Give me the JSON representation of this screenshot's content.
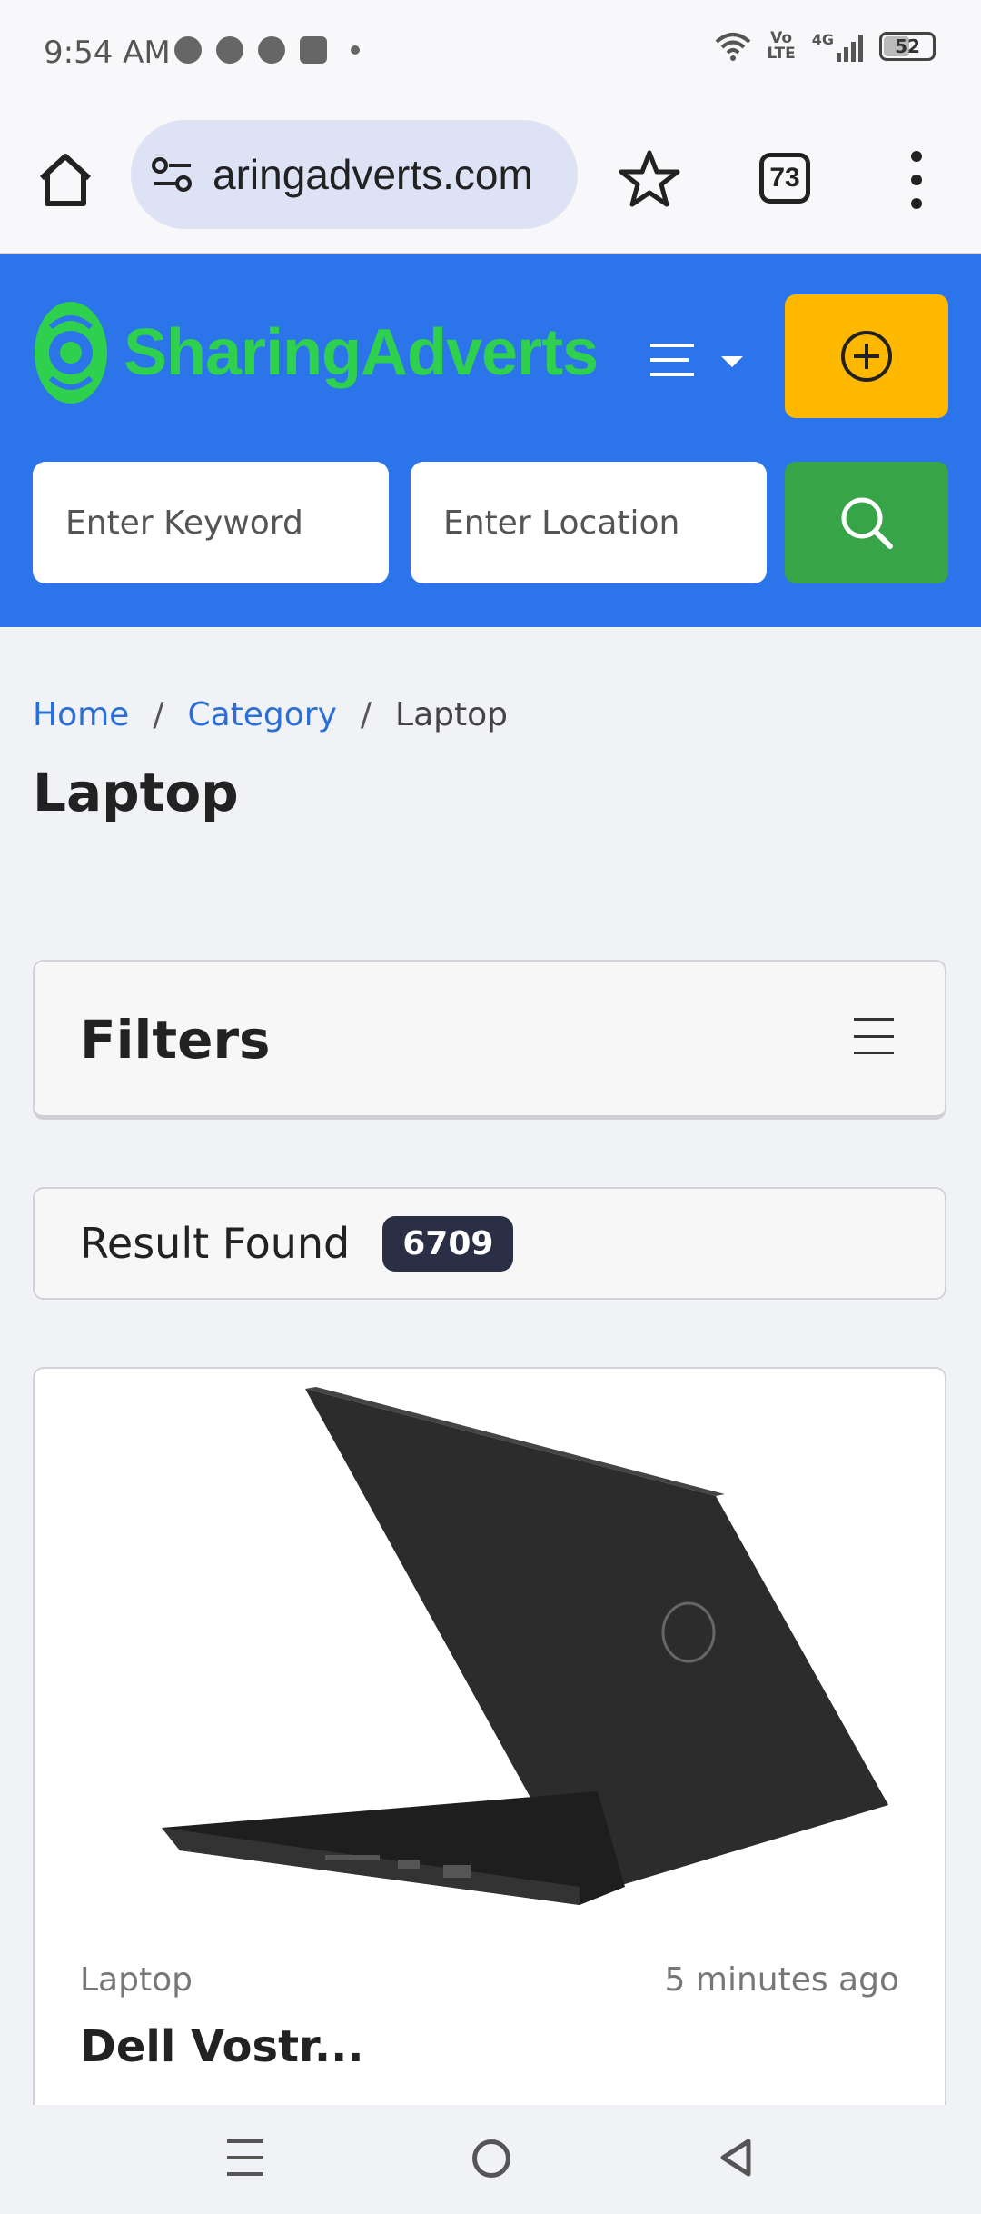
{
  "status_bar": {
    "time": "9:54 AM",
    "volte_label": "Vo\nLTE",
    "network": "4G",
    "battery": "52"
  },
  "browser": {
    "url": "aringadverts.com",
    "tab_count": "73",
    "icons": [
      "home-icon",
      "site-settings-icon",
      "star-icon",
      "tabs-icon",
      "more-vert-icon"
    ]
  },
  "header": {
    "logo_text": "SharingAdverts",
    "keyword_placeholder": "Enter Keyword",
    "location_placeholder": "Enter Location",
    "colors": {
      "header_bg": "#2b74ea",
      "logo": "#2ed04e",
      "add": "#ffb800",
      "search": "#36a447"
    }
  },
  "breadcrumb": {
    "home": "Home",
    "category": "Category",
    "current": "Laptop"
  },
  "page": {
    "title": "Laptop"
  },
  "filters": {
    "title": "Filters"
  },
  "results": {
    "label": "Result Found",
    "count": "6709"
  },
  "listing": {
    "category": "Laptop",
    "time": "5 minutes ago",
    "title": "Dell Vostr..."
  }
}
